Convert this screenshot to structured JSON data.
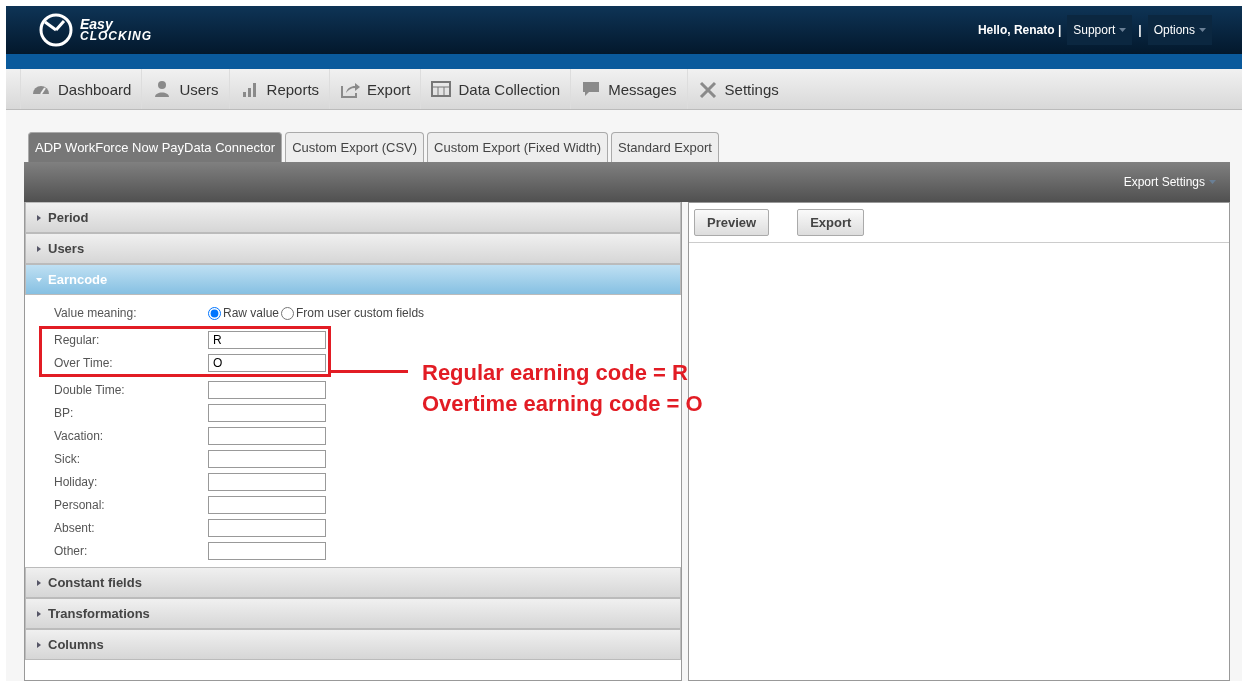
{
  "logo": {
    "line1": "Easy",
    "line2": "CLOCKING"
  },
  "user_menu": {
    "greeting": "Hello, Renato |",
    "items": [
      {
        "label": "Support"
      },
      {
        "label": "Options"
      }
    ],
    "separator": "|"
  },
  "nav": [
    {
      "label": "Dashboard",
      "kind": "gauge"
    },
    {
      "label": "Users",
      "kind": "user"
    },
    {
      "label": "Reports",
      "kind": "bars"
    },
    {
      "label": "Export",
      "kind": "share"
    },
    {
      "label": "Data Collection",
      "kind": "table"
    },
    {
      "label": "Messages",
      "kind": "chat"
    },
    {
      "label": "Settings",
      "kind": "tools"
    }
  ],
  "tabs": [
    {
      "label": "ADP WorkForce Now PayData Connector",
      "selected": true
    },
    {
      "label": "Custom Export (CSV)",
      "selected": false
    },
    {
      "label": "Custom Export (Fixed Width)",
      "selected": false
    },
    {
      "label": "Standard Export",
      "selected": false
    }
  ],
  "toolbar": {
    "settings_label": "Export Settings"
  },
  "sections": [
    {
      "title": "Period",
      "expanded": false
    },
    {
      "title": "Users",
      "expanded": false
    },
    {
      "title": "Earncode",
      "expanded": true
    },
    {
      "title": "Constant fields",
      "expanded": false
    },
    {
      "title": "Transformations",
      "expanded": false
    },
    {
      "title": "Columns",
      "expanded": false
    }
  ],
  "earncode": {
    "value_meaning_label": "Value meaning:",
    "options": [
      {
        "label": "Raw value",
        "selected": true
      },
      {
        "label": "From user custom fields",
        "selected": false
      }
    ],
    "fields": [
      {
        "label": "Regular:",
        "value": "R",
        "highlighted": true
      },
      {
        "label": "Over Time:",
        "value": "O",
        "highlighted": true
      },
      {
        "label": "Double Time:",
        "highlighted": false
      },
      {
        "label": "BP:",
        "highlighted": false
      },
      {
        "label": "Vacation:",
        "highlighted": false
      },
      {
        "label": "Sick:",
        "highlighted": false
      },
      {
        "label": "Holiday:",
        "highlighted": false
      },
      {
        "label": "Personal:",
        "highlighted": false
      },
      {
        "label": "Absent:",
        "highlighted": false
      },
      {
        "label": "Other:",
        "highlighted": false
      }
    ]
  },
  "buttons": [
    {
      "label": "Preview"
    },
    {
      "label": "Export"
    }
  ],
  "annotation": {
    "lines": [
      "Regular earning code = R",
      "Overtime earning code = O"
    ]
  }
}
